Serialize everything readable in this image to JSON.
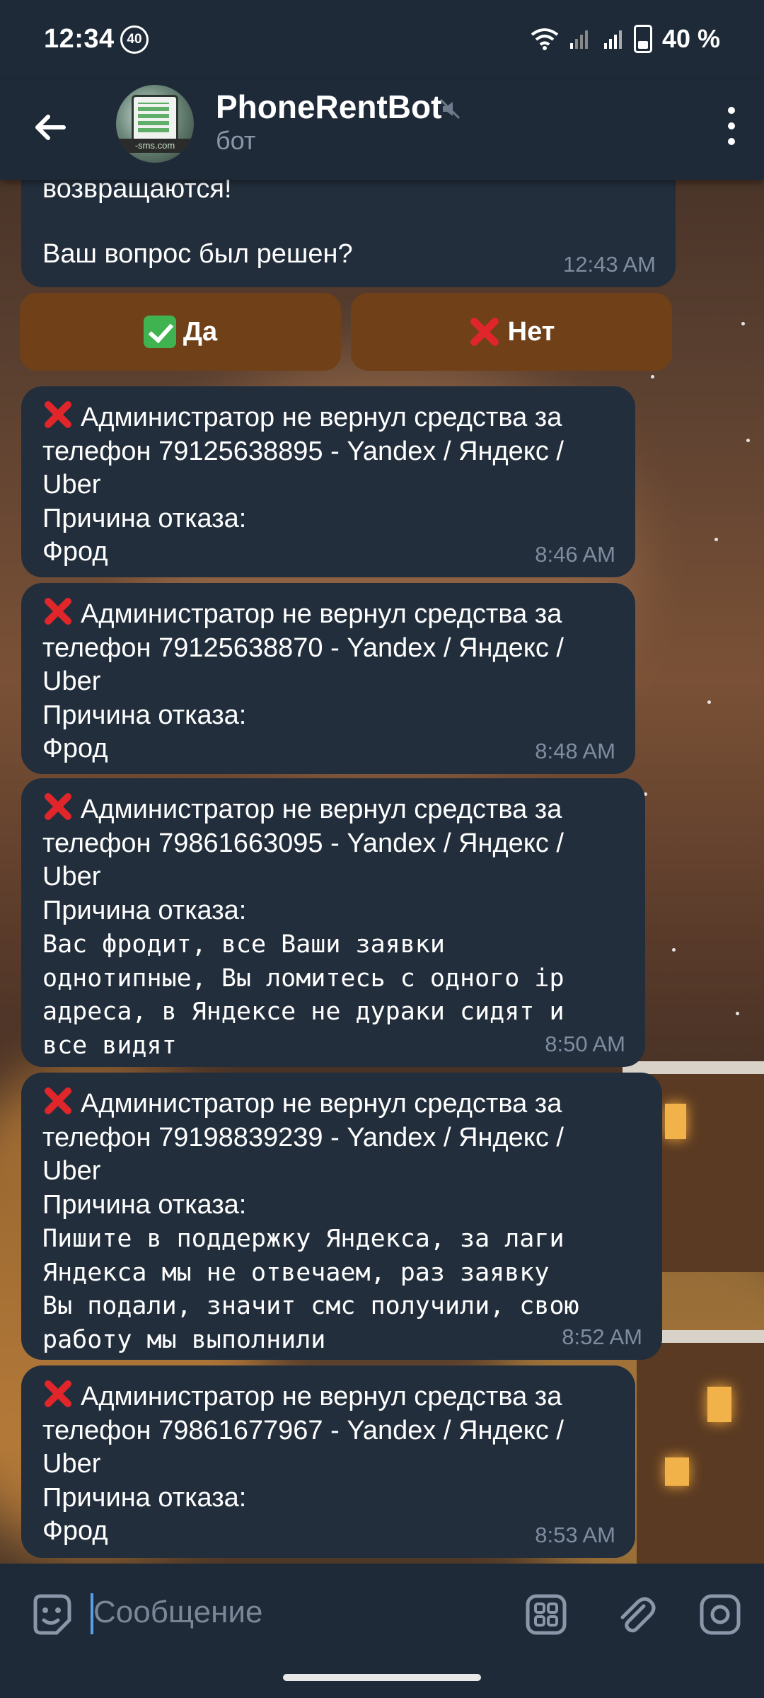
{
  "status_bar": {
    "time": "12:34",
    "badge": "40",
    "battery": "40 %"
  },
  "header": {
    "title": "PhoneRentBot",
    "subtitle": "бот",
    "avatar_text": "-sms.com"
  },
  "messages": [
    {
      "text": "возвращаются!\n\nВаш вопрос был решен?",
      "time": "12:43 AM"
    },
    {
      "line1": "Администратор не вернул средства за\nтелефон 79125638895 - Yandex / Яндекс /\nUber",
      "line2": "Причина отказа:",
      "reason": "Фрод",
      "time": "8:46 AM"
    },
    {
      "line1": "Администратор не вернул средства за\nтелефон 79125638870 - Yandex / Яндекс /\nUber",
      "line2": "Причина отказа:",
      "reason": "Фрод",
      "time": "8:48 AM"
    },
    {
      "line1": "Администратор не вернул средства за\nтелефон 79861663095 - Yandex / Яндекс /\nUber",
      "line2": "Причина отказа:",
      "reason": "Вас фродит, все Ваши заявки\nоднотипные, Вы ломитесь с одного ip\nадреса, в Яндексе не дураки сидят и\nвсе видят",
      "time": "8:50 AM"
    },
    {
      "line1": "Администратор не вернул средства за\nтелефон 79198839239 - Yandex / Яндекс /\nUber",
      "line2": "Причина отказа:",
      "reason": "Пишите в поддержку Яндекса, за лаги\nЯндекса мы не отвечаем, раз заявку\nВы подали, значит смс получили, свою\nработу мы выполнили",
      "time": "8:52 AM"
    },
    {
      "line1": "Администратор не вернул средства за\nтелефон 79861677967 - Yandex / Яндекс /\nUber",
      "line2": "Причина отказа:",
      "reason": "Фрод",
      "time": "8:53 AM"
    }
  ],
  "buttons": {
    "yes": "Да",
    "no": "Нет"
  },
  "input": {
    "placeholder": "Сообщение"
  },
  "colors": {
    "bubble": "#222e3c",
    "bar": "#1f2a38",
    "inline_button": "#704018",
    "red_x": "#e0262a"
  }
}
